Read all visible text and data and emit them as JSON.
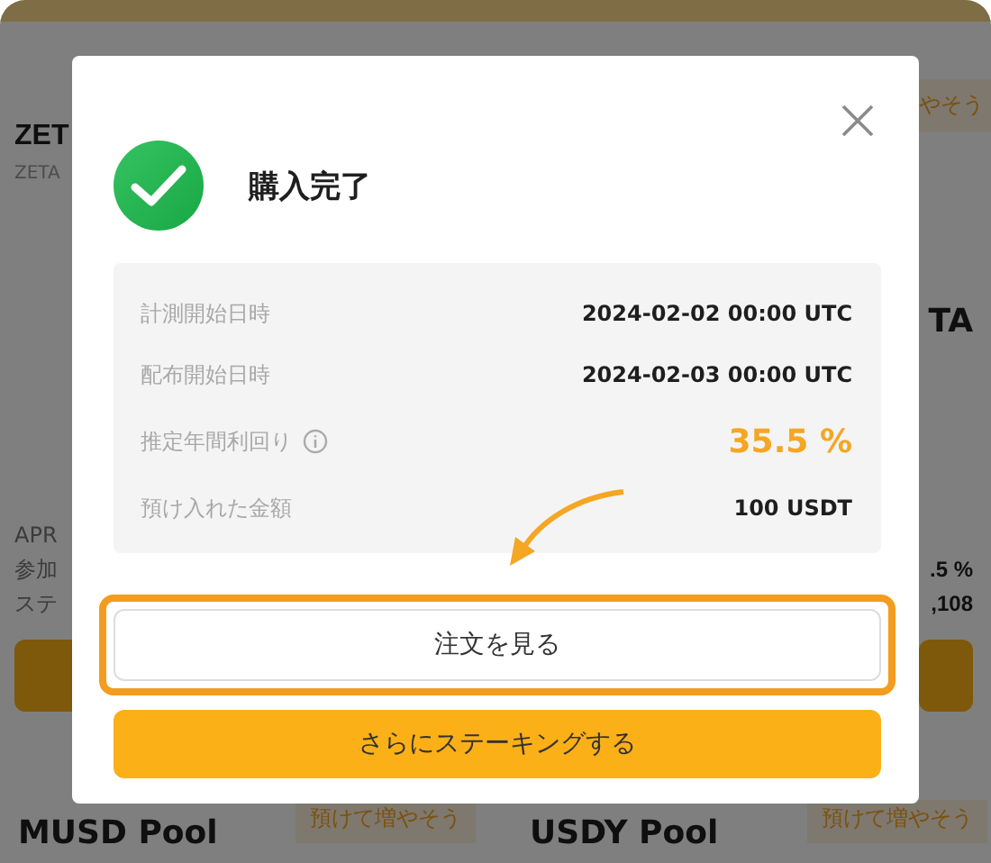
{
  "background": {
    "top_card": {
      "title": "ZET",
      "subtitle": "ZETA",
      "badge": "やそう",
      "right_title": "TA",
      "left_labels": [
        "APR",
        "参加",
        "ステ"
      ],
      "right_values": [
        ".5 %",
        ",108"
      ]
    },
    "pools": [
      {
        "name": "MUSD Pool",
        "badge": "預けて増やそう"
      },
      {
        "name": "USDY Pool",
        "badge": "預けて増やそう"
      }
    ]
  },
  "dialog": {
    "title": "購入完了",
    "rows": [
      {
        "label": "計測開始日時",
        "value": "2024-02-02 00:00 UTC",
        "kind": "plain",
        "info": false
      },
      {
        "label": "配布開始日時",
        "value": "2024-02-03 00:00 UTC",
        "kind": "plain",
        "info": false
      },
      {
        "label": "推定年間利回り",
        "value": "35.5 %",
        "kind": "highlight",
        "info": true
      },
      {
        "label": "預け入れた金額",
        "value": "100 USDT",
        "kind": "plain",
        "info": false
      }
    ],
    "buttons": [
      {
        "label": "注文を見る",
        "kind": "secondary",
        "highlighted": true
      },
      {
        "label": "さらにステーキングする",
        "kind": "primary",
        "highlighted": false
      }
    ]
  }
}
